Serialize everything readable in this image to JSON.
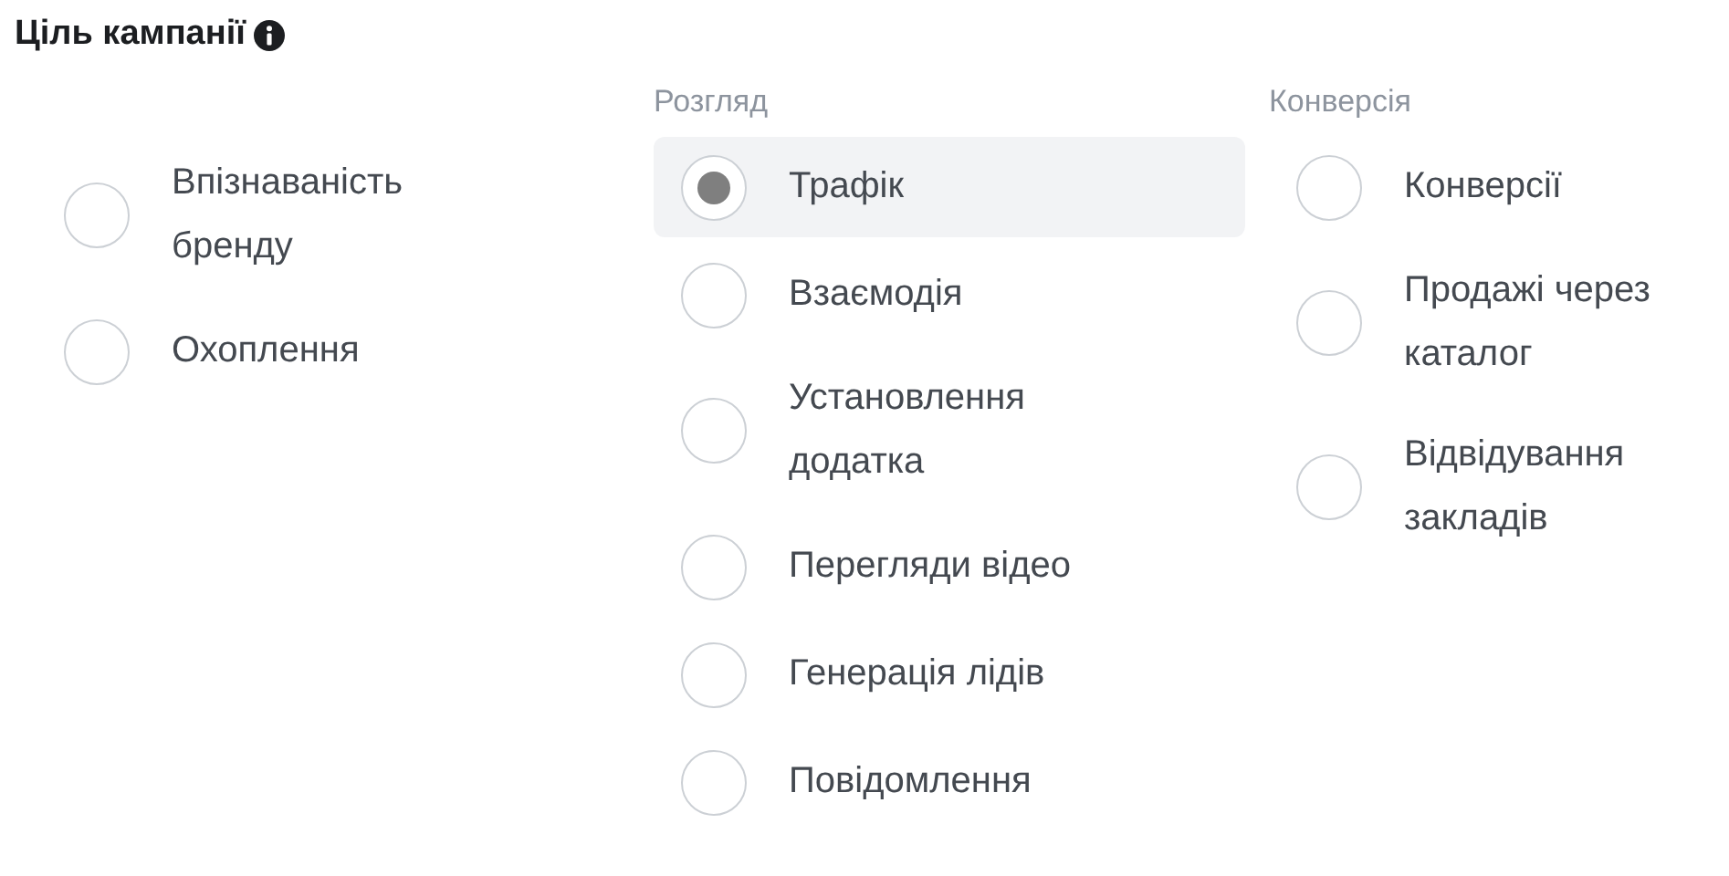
{
  "title": "Ціль кампанії",
  "columns": [
    {
      "options": [
        {
          "label": "Впізнаваність бренду",
          "selected": false
        },
        {
          "label": "Охоплення",
          "selected": false
        }
      ]
    },
    {
      "heading": "Розгляд",
      "options": [
        {
          "label": "Трафік",
          "selected": true
        },
        {
          "label": "Взаємодія",
          "selected": false
        },
        {
          "label": "Установлення додатка",
          "selected": false
        },
        {
          "label": "Перегляди відео",
          "selected": false
        },
        {
          "label": "Генерація лідів",
          "selected": false
        },
        {
          "label": "Повідомлення",
          "selected": false
        }
      ]
    },
    {
      "heading": "Конверсія",
      "options": [
        {
          "label": "Конверсії",
          "selected": false
        },
        {
          "label": "Продажі через каталог",
          "selected": false
        },
        {
          "label": "Відвідування закладів",
          "selected": false
        }
      ]
    }
  ]
}
